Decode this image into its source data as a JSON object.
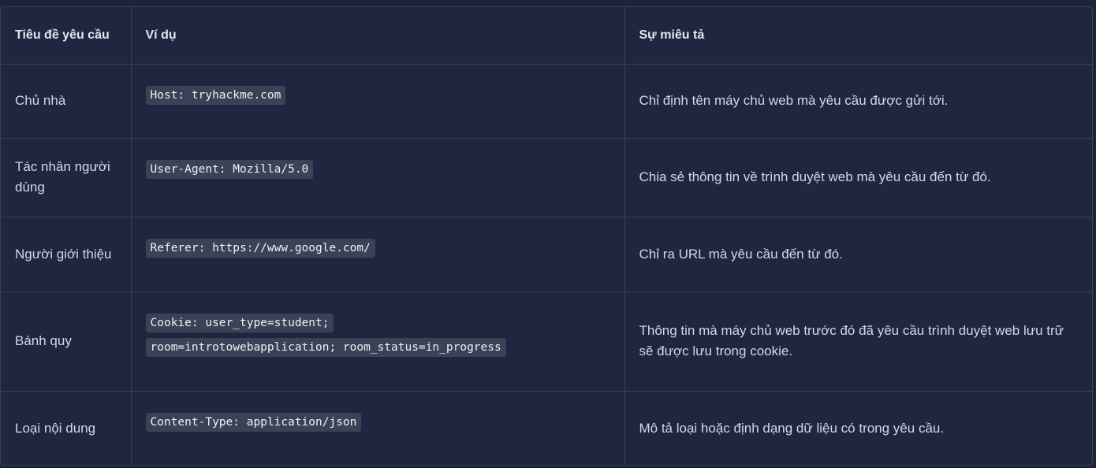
{
  "headers": {
    "header_name": "Tiêu đề yêu cầu",
    "example": "Ví dụ",
    "description": "Sự miêu tả"
  },
  "rows": [
    {
      "name": "Chủ nhà",
      "example": "Host: tryhackme.com",
      "description": "Chỉ định tên máy chủ web mà yêu cầu được gửi tới."
    },
    {
      "name": "Tác nhân người dùng",
      "example": "User-Agent: Mozilla/5.0",
      "description": "Chia sẻ thông tin về trình duyệt web mà yêu cầu đến từ đó."
    },
    {
      "name": "Người giới thiệu",
      "example": "Referer: https://www.google.com/",
      "description": "Chỉ ra URL mà yêu cầu đến từ đó."
    },
    {
      "name": "Bánh quy",
      "example": "Cookie: user_type=student; room=introtowebapplication; room_status=in_progress",
      "description": "Thông tin mà máy chủ web trước đó đã yêu cầu trình duyệt web lưu trữ sẽ được lưu trong cookie."
    },
    {
      "name": "Loại nội dung",
      "example": "Content-Type: application/json",
      "description": "Mô tả loại hoặc định dạng dữ liệu có trong yêu cầu."
    }
  ]
}
